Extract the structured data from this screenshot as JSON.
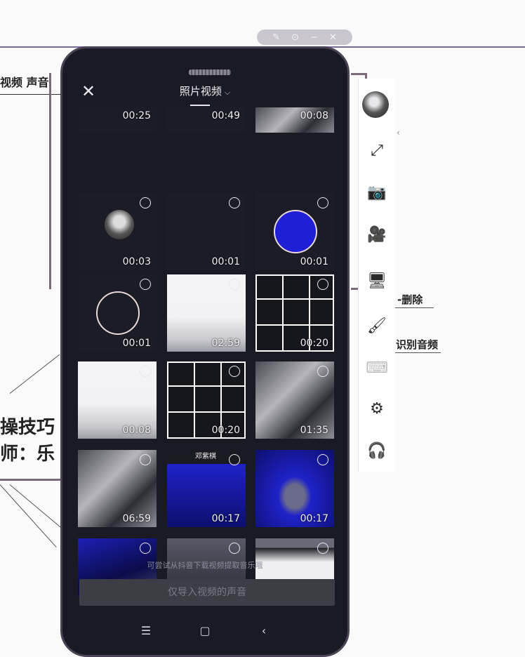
{
  "window_controls": [
    "✎",
    "⊙",
    "−",
    "✕"
  ],
  "background": {
    "top_text": "视频 声音",
    "delete_label": "-删除",
    "recognize_label": "识别音频",
    "tips_label": "操技巧",
    "teacher_label": "师：乐"
  },
  "picker": {
    "title": "照片视频",
    "close_icon": "close-icon",
    "hint": "可尝试从抖音下载视频提取音乐哦",
    "import_button": "仅导入视频的声音",
    "items": [
      {
        "duration": "00:25",
        "thumb": "dark"
      },
      {
        "duration": "00:49",
        "thumb": "dark"
      },
      {
        "duration": "00:08",
        "thumb": "photo"
      },
      {
        "duration": "00:03",
        "thumb": "dark"
      },
      {
        "duration": "00:01",
        "thumb": "dark"
      },
      {
        "duration": "00:01",
        "thumb": "blue-circle"
      },
      {
        "duration": "00:01",
        "thumb": "dark-circle"
      },
      {
        "duration": "02:59",
        "thumb": "white"
      },
      {
        "duration": "00:20",
        "thumb": "grid"
      },
      {
        "duration": "00:08",
        "thumb": "white"
      },
      {
        "duration": "00:20",
        "thumb": "grid"
      },
      {
        "duration": "01:35",
        "thumb": "photo"
      },
      {
        "duration": "06:59",
        "thumb": "photo"
      },
      {
        "duration": "00:17",
        "thumb": "blue"
      },
      {
        "duration": "00:17",
        "thumb": "blue"
      },
      {
        "duration": "",
        "thumb": "blue2"
      },
      {
        "duration": "",
        "thumb": "woman"
      },
      {
        "duration": "",
        "thumb": "portrait"
      }
    ],
    "thumb_caption": "邓紫棋",
    "nav": [
      "menu-icon",
      "home-icon",
      "back-icon"
    ]
  },
  "toolbar": {
    "items": [
      "avatar",
      "fullscreen-icon",
      "camera-icon",
      "video-camera-icon",
      "screen-icon",
      "brush-icon",
      "keyboard-icon",
      "settings-icon",
      "headset-icon"
    ]
  }
}
